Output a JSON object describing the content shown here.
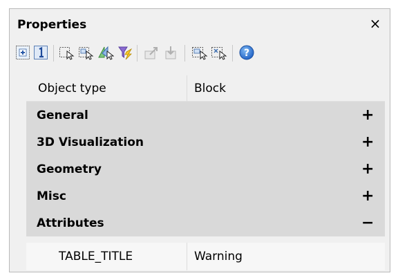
{
  "panel": {
    "title": "Properties",
    "close_glyph": "×"
  },
  "toolbar": {
    "buttons": [
      {
        "icon": "select-all-icon"
      },
      {
        "icon": "toggle-pickadd-icon"
      },
      {
        "icon": "select-objects-icon"
      },
      {
        "icon": "quick-select-icon"
      },
      {
        "icon": "select-similar-icon"
      },
      {
        "icon": "filter-icon"
      },
      {
        "icon": "export-icon"
      },
      {
        "icon": "import-icon"
      },
      {
        "icon": "select-window-icon"
      },
      {
        "icon": "deselect-icon"
      },
      {
        "icon": "help-icon"
      }
    ]
  },
  "object_type": {
    "label": "Object type",
    "value": "Block"
  },
  "categories": [
    {
      "label": "General",
      "state": "+"
    },
    {
      "label": "3D Visualization",
      "state": "+"
    },
    {
      "label": "Geometry",
      "state": "+"
    },
    {
      "label": "Misc",
      "state": "+"
    },
    {
      "label": "Attributes",
      "state": "−"
    }
  ],
  "attributes": {
    "name": "TABLE_TITLE",
    "value": "Warning"
  }
}
